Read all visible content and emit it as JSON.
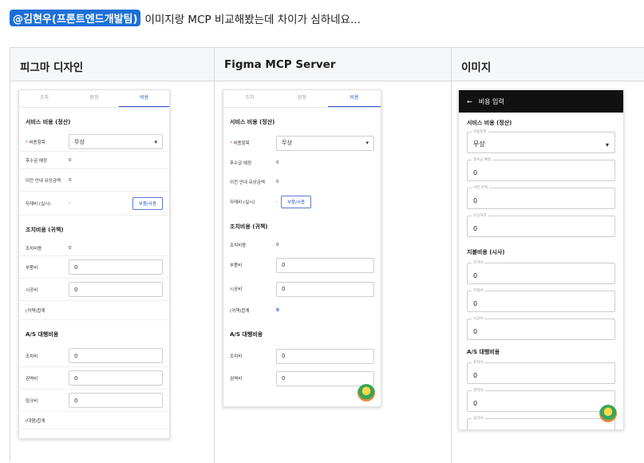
{
  "message": {
    "mention": "@김현우(프론트엔드개발팀)",
    "text": "이미지랑 MCP 비교해봤는데 차이가 심하네요..."
  },
  "columns": [
    "피그마 디자인",
    "Figma MCP Server",
    "이미지"
  ],
  "figma": {
    "tabs": [
      "조치",
      "완정",
      "비용"
    ],
    "sec1": "서비스 비용 (정산)",
    "item_label": "비용항목",
    "item_value": "무상",
    "r1": "후수금 예정",
    "r1v": "0",
    "r2": "이전 안내 유상금액",
    "r2v": "0",
    "r3": "자재비 (실시)",
    "r3v": "-",
    "btn": "부품/사용",
    "sec2": "조치비용 (귀책)",
    "r4": "조치비용",
    "r4v": "0",
    "r5": "부품비",
    "r5v": "0",
    "r6": "시공비",
    "r6v": "0",
    "r7": "(귀책)합계",
    "sec3": "A/S 대행비용",
    "r8": "조치비",
    "r8v": "0",
    "r9": "권역비",
    "r9v": "0",
    "r10": "링크비",
    "r10v": "0",
    "r11": "(대행)합계"
  },
  "mcp": {
    "tabs": [
      "조치",
      "완정",
      "비용"
    ],
    "sec1": "서비스 비용 (정산)",
    "item_label": "비용항목",
    "item_value": "무상",
    "r1": "후수금 예정",
    "r1v": "0",
    "r2": "이전 안내 유상금액",
    "r2v": "0",
    "r3": "자재비 (실시)",
    "r3v": "-",
    "btn": "부품/사용",
    "sec2": "조치비용 (귀책)",
    "r4": "조치비용",
    "r4v": "0",
    "r5": "부품비",
    "r5v": "0",
    "r6": "시공비",
    "r6v": "0",
    "r7": "(귀책)합계",
    "r7v": "0",
    "sec3": "A/S 대행비용",
    "r8": "조치비",
    "r8v": "0",
    "r9": "권역비",
    "r9v": "0"
  },
  "image": {
    "title": "비용 입력",
    "sec1": "서비스 비용 (정산)",
    "f1": "비용항목",
    "f1v": "무상",
    "f2": "후수금 예정",
    "f2v": "0",
    "f3": "이전 잔액",
    "f3v": "0",
    "f4": "유상처리",
    "f4v": "0",
    "sec2": "지불비용 (시사)",
    "f5": "조치비",
    "f5v": "0",
    "f6": "부품비",
    "f6v": "0",
    "f7": "시공비",
    "f7v": "0",
    "sec3": "A/S 대행비용",
    "f8": "조치비",
    "f8v": "0",
    "f9": "권역비",
    "f9v": "0",
    "f10": "링크비"
  }
}
